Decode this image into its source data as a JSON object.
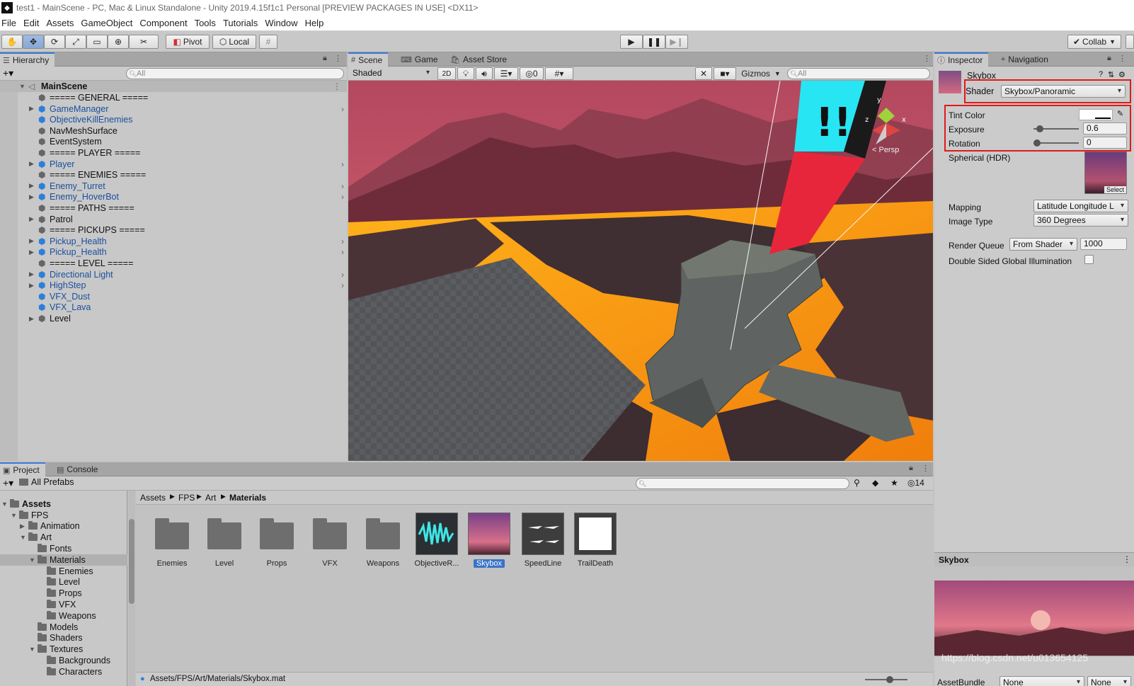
{
  "window": {
    "title": "test1 - MainScene - PC, Mac & Linux Standalone - Unity 2019.4.15f1c1 Personal [PREVIEW PACKAGES IN USE] <DX11>"
  },
  "menu": [
    "File",
    "Edit",
    "Assets",
    "GameObject",
    "Component",
    "Tools",
    "Tutorials",
    "Window",
    "Help"
  ],
  "toolbar": {
    "pivot_label": "Pivot",
    "local_label": "Local",
    "collab_label": "Collab"
  },
  "hierarchy": {
    "tab_label": "Hierarchy",
    "search_placeholder": "All",
    "scene_name": "MainScene",
    "items": [
      {
        "label": "===== GENERAL =====",
        "prefab": false,
        "expandable": false
      },
      {
        "label": "GameManager",
        "prefab": true,
        "expandable": true
      },
      {
        "label": "ObjectiveKillEnemies",
        "prefab": true,
        "expandable": false
      },
      {
        "label": "NavMeshSurface",
        "prefab": false,
        "expandable": false
      },
      {
        "label": "EventSystem",
        "prefab": false,
        "expandable": false
      },
      {
        "label": "===== PLAYER =====",
        "prefab": false,
        "expandable": false
      },
      {
        "label": "Player",
        "prefab": true,
        "expandable": true
      },
      {
        "label": "===== ENEMIES =====",
        "prefab": false,
        "expandable": false
      },
      {
        "label": "Enemy_Turret",
        "prefab": true,
        "expandable": true
      },
      {
        "label": "Enemy_HoverBot",
        "prefab": true,
        "expandable": true
      },
      {
        "label": "===== PATHS =====",
        "prefab": false,
        "expandable": false
      },
      {
        "label": "Patrol",
        "prefab": false,
        "expandable": true
      },
      {
        "label": "===== PICKUPS =====",
        "prefab": false,
        "expandable": false
      },
      {
        "label": "Pickup_Health",
        "prefab": true,
        "expandable": true
      },
      {
        "label": "Pickup_Health",
        "prefab": true,
        "expandable": true
      },
      {
        "label": "===== LEVEL =====",
        "prefab": false,
        "expandable": false
      },
      {
        "label": "Directional Light",
        "prefab": true,
        "expandable": true
      },
      {
        "label": "HighStep",
        "prefab": true,
        "expandable": true
      },
      {
        "label": "VFX_Dust",
        "prefab": true,
        "expandable": false
      },
      {
        "label": "VFX_Lava",
        "prefab": true,
        "expandable": false
      },
      {
        "label": "Level",
        "prefab": false,
        "expandable": true
      }
    ]
  },
  "scene": {
    "tabs": [
      "Scene",
      "Game",
      "Asset Store"
    ],
    "draw_mode": "Shaded",
    "mode_2d": "2D",
    "hidden_count": "0",
    "gizmos_label": "Gizmos",
    "search_placeholder": "All",
    "persp_label": "< Persp"
  },
  "inspector": {
    "tabs": [
      "Inspector",
      "Navigation"
    ],
    "material_name": "Skybox",
    "shader_label": "Shader",
    "shader_value": "Skybox/Panoramic",
    "tint_label": "Tint Color",
    "exposure_label": "Exposure",
    "exposure_value": "0.6",
    "exposure_fraction": 0.075,
    "rotation_label": "Rotation",
    "rotation_value": "0",
    "rotation_fraction": 0.0,
    "spherical_label": "Spherical  (HDR)",
    "select_label": "Select",
    "mapping_label": "Mapping",
    "mapping_value": "Latitude Longitude L",
    "image_type_label": "Image Type",
    "image_type_value": "360 Degrees",
    "render_queue_label": "Render Queue",
    "render_queue_mode": "From Shader",
    "render_queue_value": "1000",
    "double_sided_label": "Double Sided Global Illumination",
    "preview_title": "Skybox",
    "asset_bundle_label": "AssetBundle",
    "asset_bundle_value": "None",
    "asset_bundle_variant": "None"
  },
  "project": {
    "tabs": [
      "Project",
      "Console"
    ],
    "hidden_count": "14",
    "breadcrumb": [
      "Assets",
      "FPS",
      "Art",
      "Materials"
    ],
    "tree": [
      {
        "label": "All Prefabs",
        "depth": 1,
        "arrow": "",
        "bold": false
      },
      {
        "label": "Assets",
        "depth": 0,
        "arrow": "▼",
        "bold": true
      },
      {
        "label": "FPS",
        "depth": 1,
        "arrow": "▼",
        "bold": false
      },
      {
        "label": "Animation",
        "depth": 2,
        "arrow": "▶",
        "bold": false
      },
      {
        "label": "Art",
        "depth": 2,
        "arrow": "▼",
        "bold": false
      },
      {
        "label": "Fonts",
        "depth": 3,
        "arrow": "",
        "bold": false
      },
      {
        "label": "Materials",
        "depth": 3,
        "arrow": "▼",
        "bold": false,
        "selected": true
      },
      {
        "label": "Enemies",
        "depth": 4,
        "arrow": "",
        "bold": false
      },
      {
        "label": "Level",
        "depth": 4,
        "arrow": "",
        "bold": false
      },
      {
        "label": "Props",
        "depth": 4,
        "arrow": "",
        "bold": false
      },
      {
        "label": "VFX",
        "depth": 4,
        "arrow": "",
        "bold": false
      },
      {
        "label": "Weapons",
        "depth": 4,
        "arrow": "",
        "bold": false
      },
      {
        "label": "Models",
        "depth": 3,
        "arrow": "",
        "bold": false
      },
      {
        "label": "Shaders",
        "depth": 3,
        "arrow": "",
        "bold": false
      },
      {
        "label": "Textures",
        "depth": 3,
        "arrow": "▼",
        "bold": false
      },
      {
        "label": "Backgrounds",
        "depth": 4,
        "arrow": "",
        "bold": false
      },
      {
        "label": "Characters",
        "depth": 4,
        "arrow": "",
        "bold": false
      }
    ],
    "assets": [
      {
        "label": "Enemies",
        "kind": "folder"
      },
      {
        "label": "Level",
        "kind": "folder"
      },
      {
        "label": "Props",
        "kind": "folder"
      },
      {
        "label": "VFX",
        "kind": "folder"
      },
      {
        "label": "Weapons",
        "kind": "folder"
      },
      {
        "label": "ObjectiveR...",
        "kind": "objective"
      },
      {
        "label": "Skybox",
        "kind": "skybox",
        "selected": true
      },
      {
        "label": "SpeedLine",
        "kind": "speedline"
      },
      {
        "label": "TrailDeath",
        "kind": "trail"
      }
    ],
    "status_path": "Assets/FPS/Art/Materials/Skybox.mat"
  },
  "watermark": "https://blog.csdn.net/u013654125"
}
